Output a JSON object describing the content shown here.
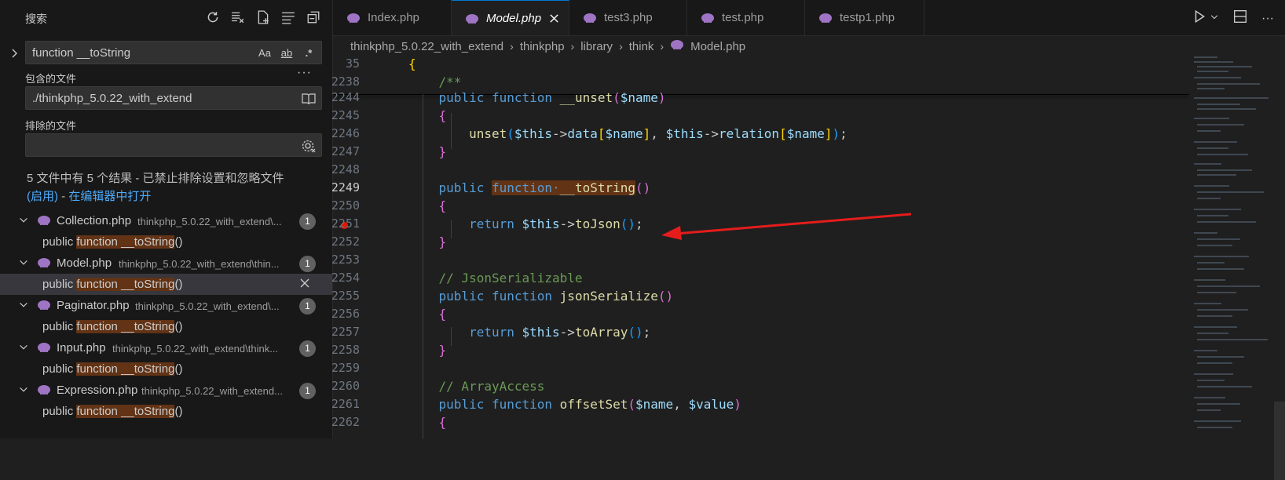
{
  "sidebar": {
    "title": "搜索",
    "search_value": "function __toString",
    "opt_case": "Aa",
    "opt_word": "ab",
    "opt_regex": ".*",
    "more_label": "···",
    "include_label": "包含的文件",
    "include_value": "./thinkphp_5.0.22_with_extend",
    "exclude_label": "排除的文件",
    "exclude_value": "",
    "summary_text": "5 文件中有 5 个结果 - 已禁止排除设置和忽略文件",
    "summary_enable": "(启用)",
    "summary_dash": " - ",
    "summary_open": "在编辑器中打开",
    "results": [
      {
        "file": "Collection.php",
        "path": "thinkphp_5.0.22_with_extend\\...",
        "count": "1",
        "match_pre": "public ",
        "match_hl": "function __toString",
        "match_post": "()"
      },
      {
        "file": "Model.php",
        "path": "thinkphp_5.0.22_with_extend\\thin...",
        "count": "1",
        "match_pre": "public ",
        "match_hl": "function __toString",
        "match_post": "()"
      },
      {
        "file": "Paginator.php",
        "path": "thinkphp_5.0.22_with_extend\\...",
        "count": "1",
        "match_pre": "public ",
        "match_hl": "function __toString",
        "match_post": "()"
      },
      {
        "file": "Input.php",
        "path": "thinkphp_5.0.22_with_extend\\think...",
        "count": "1",
        "match_pre": "public ",
        "match_hl": "function __toString",
        "match_post": "()"
      },
      {
        "file": "Expression.php",
        "path": "thinkphp_5.0.22_with_extend...",
        "count": "1",
        "match_pre": "public ",
        "match_hl": "function __toString",
        "match_post": "()"
      }
    ]
  },
  "tabs": [
    {
      "label": "Index.php"
    },
    {
      "label": "Model.php"
    },
    {
      "label": "test3.php"
    },
    {
      "label": "test.php"
    },
    {
      "label": "testp1.php"
    }
  ],
  "breadcrumb": [
    "thinkphp_5.0.22_with_extend",
    "thinkphp",
    "library",
    "think",
    "Model.php"
  ],
  "editor": {
    "line_numbers": [
      "35",
      "2238",
      "2244",
      "2245",
      "2246",
      "2247",
      "2248",
      "2249",
      "2250",
      "2251",
      "2252",
      "2253",
      "2254",
      "2255",
      "2256",
      "2257",
      "2258",
      "2259",
      "2260",
      "2261",
      "2262"
    ],
    "t_brace_open": "{",
    "t_brace_close": "}",
    "t_doc": "/**",
    "t_public": "public",
    "t_function": "function",
    "t_unset_fn": "__unset",
    "t_name": "$name",
    "t_unset": "unset",
    "t_this": "$this",
    "t_arrow": "->",
    "t_data": "data",
    "t_relation": "relation",
    "t_tostring": "__toString",
    "t_return": "return",
    "t_tojson": "toJson",
    "t_comment1": "// JsonSerializable",
    "t_jsonser": "jsonSerialize",
    "t_toarray": "toArray",
    "t_comment2": "// ArrayAccess",
    "t_offsetset": "offsetSet",
    "t_value": "$value"
  }
}
